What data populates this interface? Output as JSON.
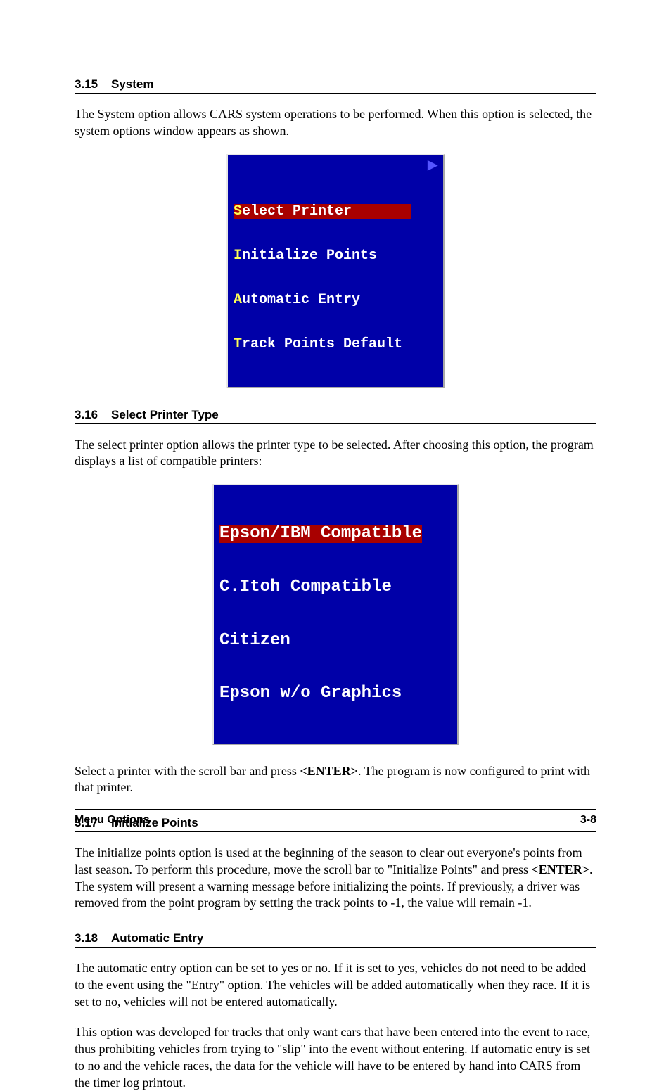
{
  "sections": {
    "s315": {
      "num": "3.15",
      "title": "System",
      "p1": "The System option allows CARS system operations to be performed. When this option is selected, the system options window appears as shown."
    },
    "s316": {
      "num": "3.16",
      "title": "Select Printer Type",
      "p1": "The select printer option allows the printer type to be selected. After choosing this option, the program displays a list of compatible printers:",
      "p2a": "Select a printer with the scroll bar and press ",
      "p2key": "<ENTER>",
      "p2b": ". The program is now configured to print with that printer."
    },
    "s317": {
      "num": "3.17",
      "title": "Initialize Points",
      "p1a": "The initialize points option is used at the beginning of the season to clear out everyone's points from last season. To perform this procedure, move the scroll bar to \"Initialize Points\" and press ",
      "p1key": "<ENTER>",
      "p1b": ". The system will present a warning message before initializing the points. If previously, a driver was removed from the point program by setting the track points to -1, the value will remain -1."
    },
    "s318": {
      "num": "3.18",
      "title": "Automatic Entry",
      "p1": "The automatic entry option can be set to yes or no. If it is set to yes, vehicles do not need to be added to the event using the \"Entry\" option. The vehicles will be added automatically when they race. If it is set to no, vehicles will not be entered automatically.",
      "p2": "This option was developed for tracks that only want cars that have been entered into the event to race, thus prohibiting vehicles from trying to \"slip\" into the event without entering. If automatic entry is set to no and the vehicle races, the data for the vehicle will have to be entered by hand into CARS from the timer log printout."
    }
  },
  "menu1": {
    "item0": {
      "hot": "S",
      "rest": "elect Printer"
    },
    "item1": {
      "hot": "I",
      "rest": "nitialize Points"
    },
    "item2": {
      "hot": "A",
      "rest": "utomatic Entry"
    },
    "item3": {
      "hot": "T",
      "rest": "rack Points Default"
    },
    "arrow": "▶"
  },
  "menu2": {
    "item0": "Epson/IBM Compatible",
    "item1": "C.Itoh Compatible",
    "item2": "Citizen",
    "item3": "Epson w/o Graphics"
  },
  "footer": {
    "left": "Menu Options",
    "right": "3-8"
  }
}
